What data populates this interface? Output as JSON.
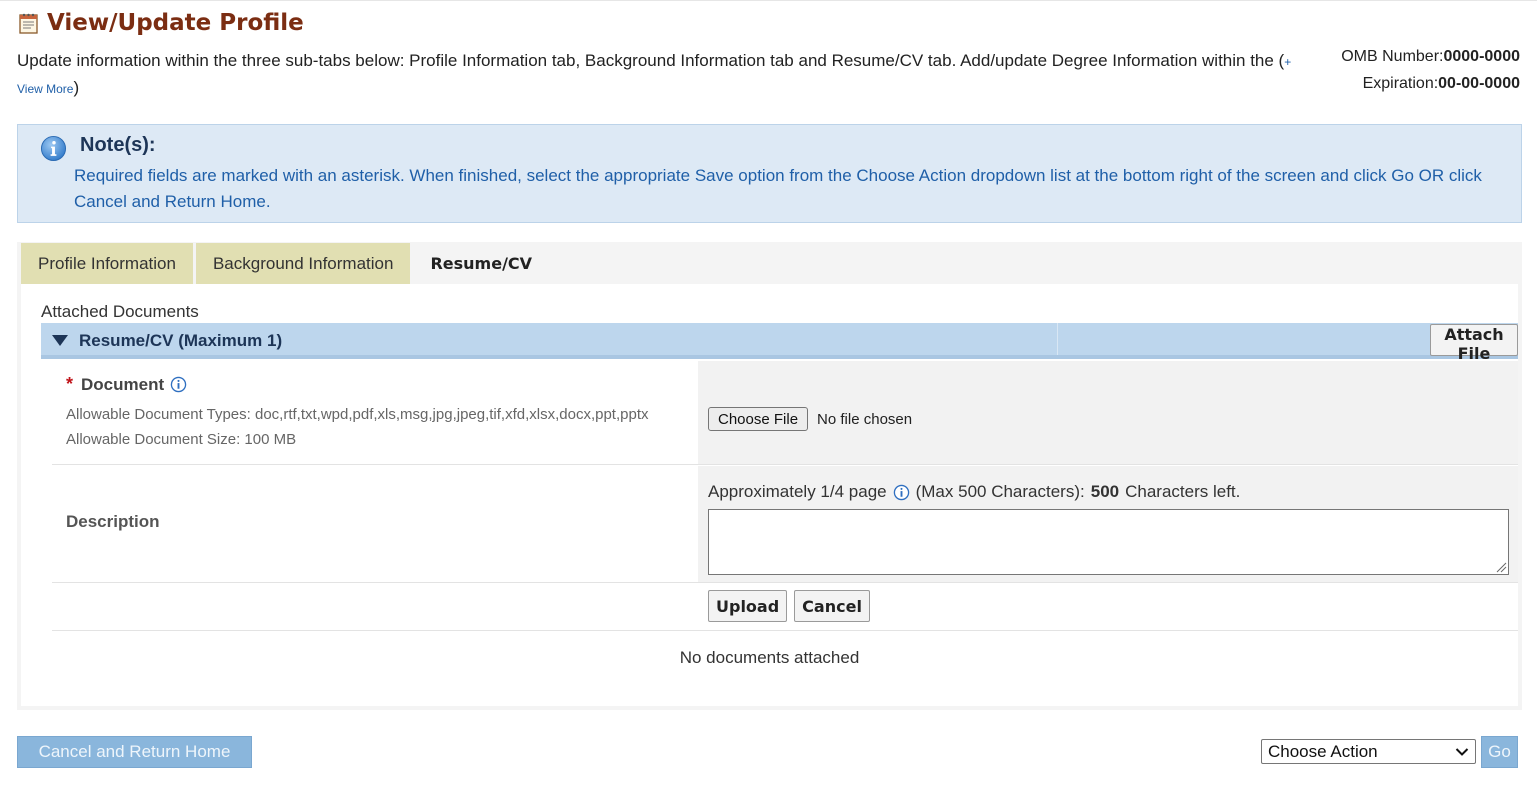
{
  "header": {
    "title": "View/Update Profile",
    "intro_text": "Update information within the three sub-tabs below: Profile Information tab, Background Information tab and Resume/CV tab. Add/update Degree Information within the (",
    "view_more_plus": "+",
    "view_more": "View More",
    "view_more_close": ")",
    "omb_label": "OMB Number:",
    "omb_value": "0000-0000",
    "expiration_label": "Expiration:",
    "expiration_value": "00-00-0000"
  },
  "note": {
    "title": "Note(s):",
    "text": "Required fields are marked with an asterisk. When finished, select the appropriate Save option from the Choose Action dropdown list at the bottom right of the screen and click Go OR click Cancel and Return Home."
  },
  "tabs": [
    {
      "label": "Profile Information",
      "active": false
    },
    {
      "label": "Background Information",
      "active": false
    },
    {
      "label": "Resume/CV",
      "active": true
    }
  ],
  "attachments": {
    "label": "Attached Documents",
    "section_title": "Resume/CV (Maximum 1)",
    "attach_button": "Attach File",
    "document_label": "Document",
    "required_marker": "*",
    "allowable_types": "Allowable Document Types: doc,rtf,txt,wpd,pdf,xls,msg,jpg,jpeg,tif,xfd,xlsx,docx,ppt,pptx",
    "allowable_size": "Allowable Document Size: 100 MB",
    "choose_file_button": "Choose File",
    "no_file_text": "No file chosen",
    "description_label": "Description",
    "description_hint_prefix": "Approximately 1/4 page",
    "description_hint_max": "(Max 500 Characters):",
    "chars_left": "500",
    "chars_left_suffix": "Characters left.",
    "description_value": "",
    "upload_button": "Upload",
    "cancel_button": "Cancel",
    "no_documents": "No documents attached"
  },
  "footer": {
    "cancel_home_button": "Cancel and Return Home",
    "action_select_value": "Choose Action",
    "go_button": "Go"
  },
  "colors": {
    "title": "#7b2d12",
    "link": "#1f5fa8",
    "note_bg": "#dde9f5",
    "tab_inactive": "#e1dfb2",
    "section_bar": "#bdd6ed",
    "primary_button": "#8ab6dc",
    "required": "#c0141a"
  },
  "icons": {
    "title": "notepad-icon",
    "note": "info-circle-icon",
    "section_toggle": "triangle-down-icon",
    "field_help": "info-icon",
    "select_arrow": "chevron-down-icon"
  }
}
